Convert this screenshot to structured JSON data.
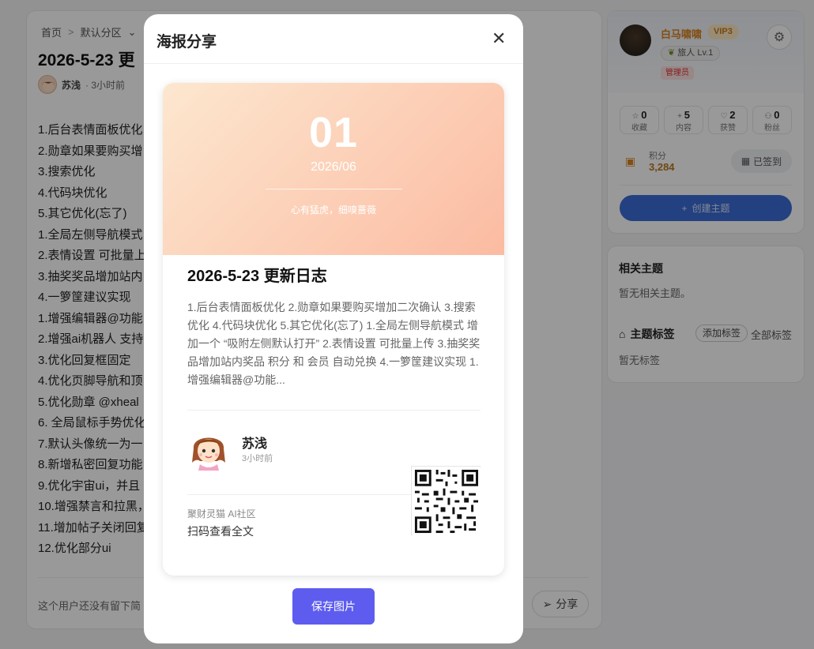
{
  "article": {
    "breadcrumb_home": "首页",
    "breadcrumb_sep": ">",
    "breadcrumb_section": "默认分区",
    "title": "2026-5-23 更",
    "author": "苏浅",
    "time": "· 3小时前",
    "lines": [
      "1.后台表情面板优化",
      "2.勋章如果要购买增",
      "3.搜索优化",
      "4.代码块优化",
      "5.其它优化(忘了)",
      "1.全局左侧导航模式",
      "2.表情设置 可批量上",
      "3.抽奖奖品增加站内",
      "4.一箩筐建议实现",
      "1.增强编辑器@功能",
      "2.增强ai机器人 支持",
      "3.优化回复框固定",
      "4.优化页脚导航和顶",
      "5.优化勋章 @xheal",
      "6. 全局鼠标手势优化",
      "7.默认头像统一为一",
      "8.新增私密回复功能",
      "9.优化宇宙ui，并且",
      "10.增强禁言和拉黑，",
      "11.增加帖子关闭回复",
      "12.优化部分ui"
    ],
    "bottom_note": "这个用户还没有留下简",
    "share_label": "分享"
  },
  "profile": {
    "username": "白马啸啸",
    "vip": "VIP3",
    "level": "旅人 Lv.1",
    "role": "管理员",
    "stats": [
      {
        "value": "0",
        "label": "收藏",
        "icon": "☆"
      },
      {
        "value": "5",
        "label": "内容",
        "icon": "+"
      },
      {
        "value": "2",
        "label": "获赞",
        "icon": "♡"
      },
      {
        "value": "0",
        "label": "粉丝",
        "icon": "⚇"
      }
    ],
    "points_label": "积分",
    "points_value": "3,284",
    "signed_label": "已签到",
    "create_label": "创建主题"
  },
  "related": {
    "title": "相关主题",
    "empty": "暂无相关主题。",
    "tags_title": "主题标签",
    "add_tag": "添加标签",
    "all_tags": "全部标签",
    "tags_empty": "暂无标签"
  },
  "modal": {
    "title": "海报分享",
    "close": "✕",
    "save_label": "保存图片",
    "poster": {
      "day": "01",
      "month": "2026/06",
      "motto": "心有猛虎，细嗅蔷薇",
      "title": "2026-5-23 更新日志",
      "excerpt": "1.后台表情面板优化 2.勋章如果要购买增加二次确认 3.搜索优化 4.代码块优化 5.其它优化(忘了) 1.全局左侧导航模式 增加一个 “吸附左侧默认打开” 2.表情设置 可批量上传 3.抽奖奖品增加站内奖品 积分 和 会员 自动兑换 4.一箩筐建议实现 1.增强编辑器@功能...",
      "author": "苏浅",
      "time": "3小时前",
      "site": "聚财灵猫 AI社区",
      "scan": "扫码查看全文"
    }
  },
  "colors": {
    "accent": "#5d5cef",
    "create_button": "#3b6bd6",
    "username": "#d9831f",
    "hero_start": "#fde7cf",
    "hero_end": "#fbbba2"
  }
}
